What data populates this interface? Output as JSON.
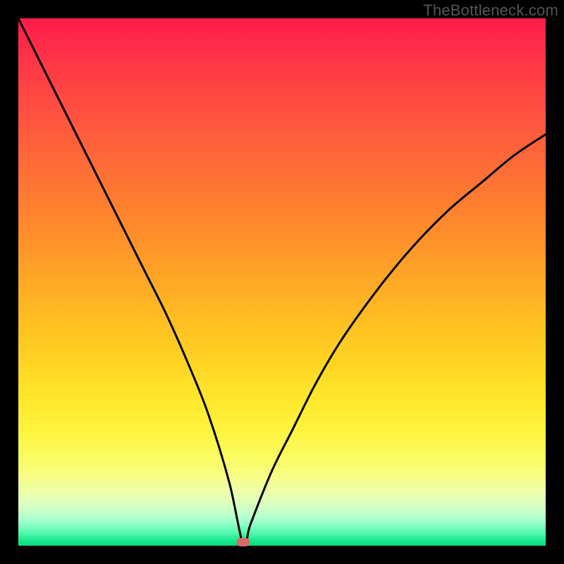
{
  "watermark": "TheBottleneck.com",
  "chart_data": {
    "type": "line",
    "title": "",
    "xlabel": "",
    "ylabel": "",
    "xlim": [
      0,
      100
    ],
    "ylim": [
      0,
      100
    ],
    "grid": false,
    "legend": false,
    "x": [
      0,
      4,
      8,
      12,
      16,
      20,
      24,
      28,
      32,
      36,
      40,
      42.7,
      44,
      48,
      52,
      56,
      60,
      64,
      70,
      76,
      82,
      88,
      94,
      100
    ],
    "y": [
      100,
      92,
      84,
      76,
      68,
      60,
      52,
      44,
      35,
      25,
      12,
      0,
      4,
      14,
      22,
      30,
      37,
      43,
      51,
      58,
      64,
      69,
      74,
      78
    ],
    "marker": {
      "x": 42.7,
      "y": 0.7,
      "color": "#d86b66"
    },
    "gradient_top_color": "#ff1a49",
    "gradient_bottom_color": "#06dd7d"
  }
}
